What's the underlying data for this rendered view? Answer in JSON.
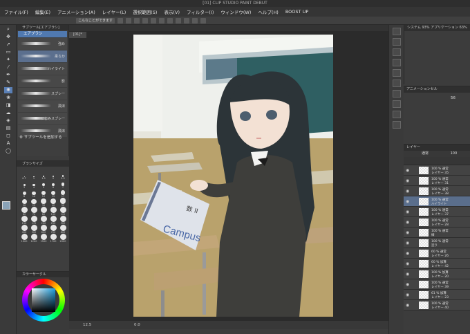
{
  "window": {
    "title": "[01] CLIP STUDIO PAINT DEBUT"
  },
  "menu": [
    "ファイル(F)",
    "編集(E)",
    "アニメーション(A)",
    "レイヤー(L)",
    "選択範囲(S)",
    "表示(V)",
    "フィルター(I)",
    "ウィンドウ(W)",
    "ヘルプ(H)",
    "BOOST UP"
  ],
  "toolbar": {
    "snap_label": "こんなことができます"
  },
  "subtool": {
    "tab": "サブツール[エアブラシ]",
    "group": "エアブラシ",
    "brushes": [
      "強め",
      "柔らか",
      "ハイライト",
      "影",
      "スプレー",
      "飛沫",
      "にじみスプレー",
      "飛沫"
    ],
    "add_label": "サブツールを追加する"
  },
  "brush_size": {
    "tab": "ブラシサイズ",
    "sizes": [
      "0.7",
      "1",
      "1.5",
      "2",
      "2.5",
      "3",
      "4",
      "5",
      "6",
      "7",
      "8",
      "10",
      "12",
      "15",
      "17",
      "20",
      "25",
      "30",
      "40",
      "50",
      "60",
      "70",
      "80",
      "100",
      "120",
      "150",
      "170",
      "200",
      "250",
      "300",
      "400",
      "500",
      "600",
      "700",
      "800",
      "1000",
      "1200",
      "1500",
      "1700",
      "2000"
    ]
  },
  "color": {
    "tab": "カラーサークル",
    "foreground": "#8aa3b8",
    "hue": "#1ea0e0"
  },
  "document": {
    "tab": "[01]*"
  },
  "status": {
    "zoom": "12.5",
    "angle": "0.0"
  },
  "navigator": {
    "tab": "システム 93% アプリケーション 63%"
  },
  "animation": {
    "tab": "アニメーションセル",
    "value": "56"
  },
  "layers": {
    "tab": "レイヤー",
    "blend_mode": "通常",
    "opacity": "100",
    "rows": [
      {
        "l1": "100 % 通常",
        "l2": "レイヤー 35"
      },
      {
        "l1": "100 % 通常",
        "l2": "レイヤー 31"
      },
      {
        "l1": "100 % 通常",
        "l2": "レイヤー 38"
      },
      {
        "l1": "100 % 通常",
        "l2": "ハイライト"
      },
      {
        "l1": "100 % 通常",
        "l2": "レイヤー 37"
      },
      {
        "l1": "100 % 通常",
        "l2": "レイヤー 28"
      },
      {
        "l1": "100 % 通常",
        "l2": "線"
      },
      {
        "l1": "100 % 通常",
        "l2": "塗り"
      },
      {
        "l1": "60 % 通常",
        "l2": "レイヤー 26"
      },
      {
        "l1": "60 % 加算",
        "l2": "レイヤー 42"
      },
      {
        "l1": "100 % 加算",
        "l2": "レイヤー 20"
      },
      {
        "l1": "100 % 通常",
        "l2": "レイヤー 39"
      },
      {
        "l1": "61 % 加算",
        "l2": "レイヤー 23"
      },
      {
        "l1": "100 % 通常",
        "l2": "レイヤー 40"
      }
    ]
  },
  "artwork": {
    "notebook_brand": "Campus",
    "notebook_label": "数 II"
  }
}
